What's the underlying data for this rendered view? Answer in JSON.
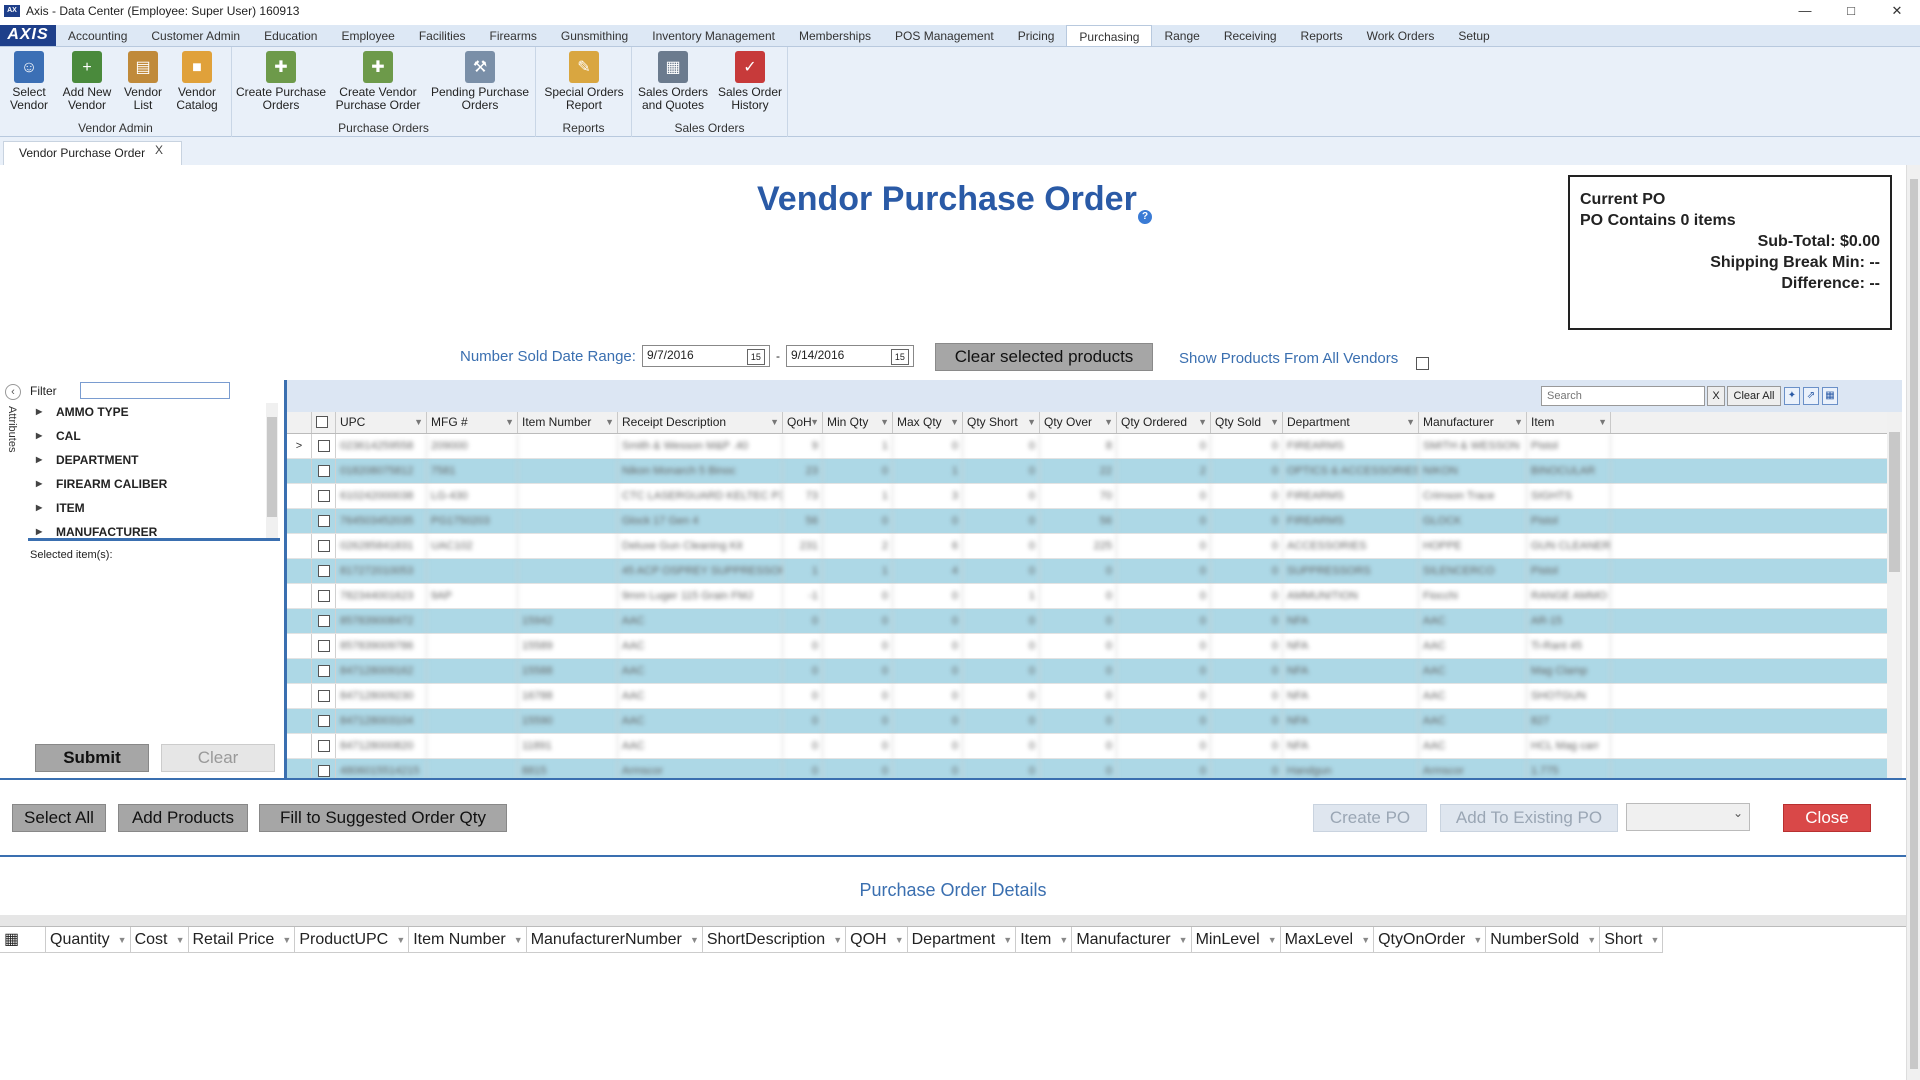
{
  "window": {
    "title": "Axis - Data Center  (Employee: Super User) 160913",
    "controls": [
      "—",
      "□",
      "✕"
    ]
  },
  "menu": {
    "brand": "AXIS",
    "items": [
      "Accounting",
      "Customer Admin",
      "Education",
      "Employee",
      "Facilities",
      "Firearms",
      "Gunsmithing",
      "Inventory Management",
      "Memberships",
      "POS Management",
      "Pricing",
      "Purchasing",
      "Range",
      "Receiving",
      "Reports",
      "Work Orders",
      "Setup"
    ],
    "active": "Purchasing"
  },
  "ribbon": {
    "groups": [
      {
        "label": "Vendor Admin",
        "buttons": [
          {
            "label": "Select\nVendor",
            "icon": "user-icon",
            "color": "#3b6fb5"
          },
          {
            "label": "Add New\nVendor",
            "icon": "add-user-icon",
            "color": "#4a8a3c"
          },
          {
            "label": "Vendor\nList",
            "icon": "contact-card-icon",
            "color": "#c08a3a"
          },
          {
            "label": "Vendor\nCatalog",
            "icon": "catalog-book-icon",
            "color": "#e0a13a"
          }
        ]
      },
      {
        "label": "Purchase Orders",
        "buttons": [
          {
            "label": "Create Purchase\nOrders",
            "icon": "create-po-icon",
            "color": "#6d9a4a"
          },
          {
            "label": "Create Vendor\nPurchase Order",
            "icon": "vendor-po-icon",
            "color": "#6d9a4a"
          },
          {
            "label": "Pending Purchase\nOrders",
            "icon": "pending-po-icon",
            "color": "#7a8fa8"
          }
        ]
      },
      {
        "label": "Reports",
        "buttons": [
          {
            "label": "Special Orders\nReport",
            "icon": "report-pencil-icon",
            "color": "#d9a640"
          }
        ]
      },
      {
        "label": "Sales Orders",
        "buttons": [
          {
            "label": "Sales Orders\nand Quotes",
            "icon": "calculator-icon",
            "color": "#6b7b8e"
          },
          {
            "label": "Sales Order\nHistory",
            "icon": "paid-stamp-icon",
            "color": "#c73a3a"
          }
        ]
      }
    ]
  },
  "doctab": {
    "label": "Vendor Purchase Order",
    "close": "X"
  },
  "page": {
    "title": "Vendor Purchase Order",
    "help": "?"
  },
  "po_summary": {
    "title": "Current PO",
    "contains": "PO Contains 0 items",
    "subtotal": "Sub-Total: $0.00",
    "shipping_min": "Shipping Break Min: --",
    "difference": "Difference: --"
  },
  "filters": {
    "date_range_label": "Number Sold Date Range:",
    "start_date": "9/7/2016",
    "end_date": "9/14/2016",
    "dash": "-",
    "cal_icon": "15",
    "clear_selected": "Clear selected products",
    "show_all_vendors": "Show Products From All Vendors"
  },
  "attributes": {
    "filter_label": "Filter",
    "side_label": "Attributes",
    "items": [
      "AMMO TYPE",
      "CAL",
      "DEPARTMENT",
      "FIREARM CALIBER",
      "ITEM",
      "MANUFACTURER"
    ],
    "selected_label": "Selected item(s):",
    "submit": "Submit",
    "clear": "Clear"
  },
  "grid": {
    "search_placeholder": "Search",
    "x": "X",
    "clear_all": "Clear All",
    "columns": [
      "UPC",
      "MFG #",
      "Item Number",
      "Receipt Description",
      "QoH",
      "Min Qty",
      "Max Qty",
      "Qty Short",
      "Qty Over",
      "Qty Ordered",
      "Qty Sold",
      "Department",
      "Manufacturer",
      "Item"
    ],
    "rows": [
      [
        "023614259558",
        "209000",
        "",
        "Smith & Wesson M&P .40",
        "9",
        "1",
        "0",
        "0",
        "8",
        "0",
        "0",
        "FIREARMS",
        "SMITH & WESSON",
        "Pistol"
      ],
      [
        "018208075812",
        "7581",
        "",
        "Nikon Monarch 5 Binoc",
        "23",
        "0",
        "1",
        "0",
        "22",
        "2",
        "0",
        "OPTICS & ACCESSORIES",
        "NIKON",
        "BINOCULAR"
      ],
      [
        "610242000038",
        "LG-430",
        "",
        "CTC LASERGUARD KELTEC P3AT",
        "73",
        "1",
        "3",
        "0",
        "70",
        "0",
        "0",
        "FIREARMS",
        "Crimson Trace",
        "SIGHTS"
      ],
      [
        "764503452035",
        "PG1750203",
        "",
        "Glock 17 Gen 4",
        "56",
        "0",
        "0",
        "0",
        "56",
        "0",
        "0",
        "FIREARMS",
        "GLOCK",
        "Pistol"
      ],
      [
        "026285841831",
        "UAC102",
        "",
        "Deluxe Gun Cleaning Kit",
        "231",
        "2",
        "6",
        "0",
        "225",
        "0",
        "0",
        "ACCESSORIES",
        "HOPPE",
        "GUN CLEANER"
      ],
      [
        "817272010053",
        "",
        "",
        "45 ACP OSPREY SUPPRESSOR",
        "1",
        "1",
        "4",
        "0",
        "0",
        "0",
        "0",
        "SUPPRESSORS",
        "SILENCERCO",
        "Pistol"
      ],
      [
        "782344001623",
        "9AP",
        "",
        "9mm Luger 115 Grain FMJ",
        "-1",
        "0",
        "0",
        "1",
        "0",
        "0",
        "0",
        "AMMUNITION",
        "Fiocchi",
        "RANGE AMMO"
      ],
      [
        "857839008472",
        "",
        "15942",
        "AAC",
        "0",
        "0",
        "0",
        "0",
        "0",
        "0",
        "0",
        "NFA",
        "AAC",
        "AR-15"
      ],
      [
        "857839009786",
        "",
        "15589",
        "AAC",
        "0",
        "0",
        "0",
        "0",
        "0",
        "0",
        "0",
        "NFA",
        "AAC",
        "Ti-Rant 45"
      ],
      [
        "847128009162",
        "",
        "15588",
        "AAC",
        "0",
        "0",
        "0",
        "0",
        "0",
        "0",
        "0",
        "NFA",
        "AAC",
        "Mag Clamp"
      ],
      [
        "847128009230",
        "",
        "16788",
        "AAC",
        "0",
        "0",
        "0",
        "0",
        "0",
        "0",
        "0",
        "NFA",
        "AAC",
        "SHOTGUN"
      ],
      [
        "847128003104",
        "",
        "15590",
        "AAC",
        "0",
        "0",
        "0",
        "0",
        "0",
        "0",
        "0",
        "NFA",
        "AAC",
        "827"
      ],
      [
        "847128000820",
        "",
        "11891",
        "AAC",
        "0",
        "0",
        "0",
        "0",
        "0",
        "0",
        "0",
        "NFA",
        "AAC",
        "HCL Mag carr"
      ],
      [
        "4806015514215",
        "",
        "8815",
        "Armscor",
        "0",
        "0",
        "0",
        "0",
        "0",
        "0",
        "0",
        "Handgun",
        "Armscor",
        "1.775"
      ]
    ]
  },
  "actions": {
    "select_all": "Select All",
    "add_products": "Add Products",
    "fill_suggested": "Fill to Suggested Order Qty",
    "create_po": "Create PO",
    "add_existing": "Add To Existing PO",
    "close": "Close"
  },
  "details": {
    "title": "Purchase Order Details",
    "columns": [
      "Quantity",
      "Cost",
      "Retail Price",
      "ProductUPC",
      "Item Number",
      "ManufacturerNumber",
      "ShortDescription",
      "QOH",
      "Department",
      "Item",
      "Manufacturer",
      "MinLevel",
      "MaxLevel",
      "QtyOnOrder",
      "NumberSold",
      "Short"
    ]
  },
  "colors": {
    "accent": "#2a5aa6",
    "row_alt": "#add8e6",
    "close_red": "#d94848"
  }
}
